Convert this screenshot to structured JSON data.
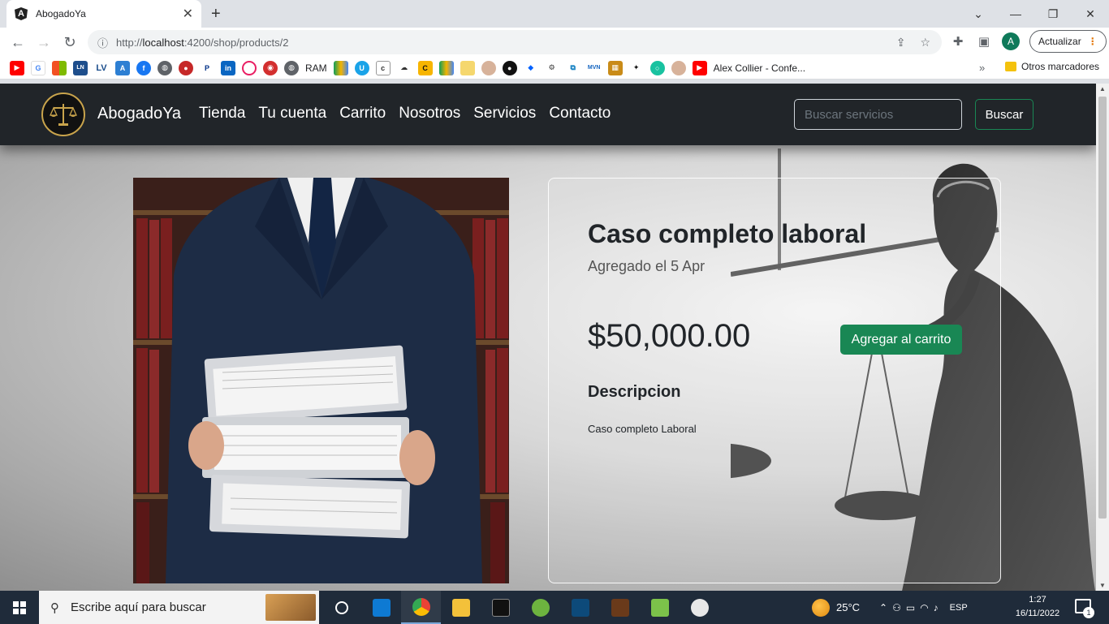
{
  "browser": {
    "tab_title": "AbogadoYa",
    "tab_favicon_text": "A",
    "url_prefix": "http://",
    "url_host": "localhost",
    "url_rest": ":4200/shop/products/2",
    "profile_initial": "A",
    "update_label": "Actualizar"
  },
  "bookmarks": {
    "ram_label": "RAM",
    "video_label": "Alex Collier - Confe...",
    "other_label": "Otros marcadores",
    "more_label": "»"
  },
  "nav": {
    "brand": "AbogadoYa",
    "links": [
      "Tienda",
      "Tu cuenta",
      "Carrito",
      "Nosotros",
      "Servicios",
      "Contacto"
    ],
    "search_placeholder": "Buscar servicios",
    "search_button": "Buscar"
  },
  "product": {
    "title": "Caso completo laboral",
    "date": "Agregado el 5 Apr",
    "price": "$50,000.00",
    "add_to_cart": "Agregar al carrito",
    "description_heading": "Descripcion",
    "description": "Caso completo Laboral"
  },
  "taskbar": {
    "search_placeholder": "Escribe aquí para buscar",
    "temperature": "25°C",
    "language": "ESP",
    "time": "1:27",
    "date": "16/11/2022",
    "notifications_count": "1"
  },
  "colors": {
    "navbar": "#212529",
    "success": "#198754",
    "gold": "#c9a44c"
  }
}
